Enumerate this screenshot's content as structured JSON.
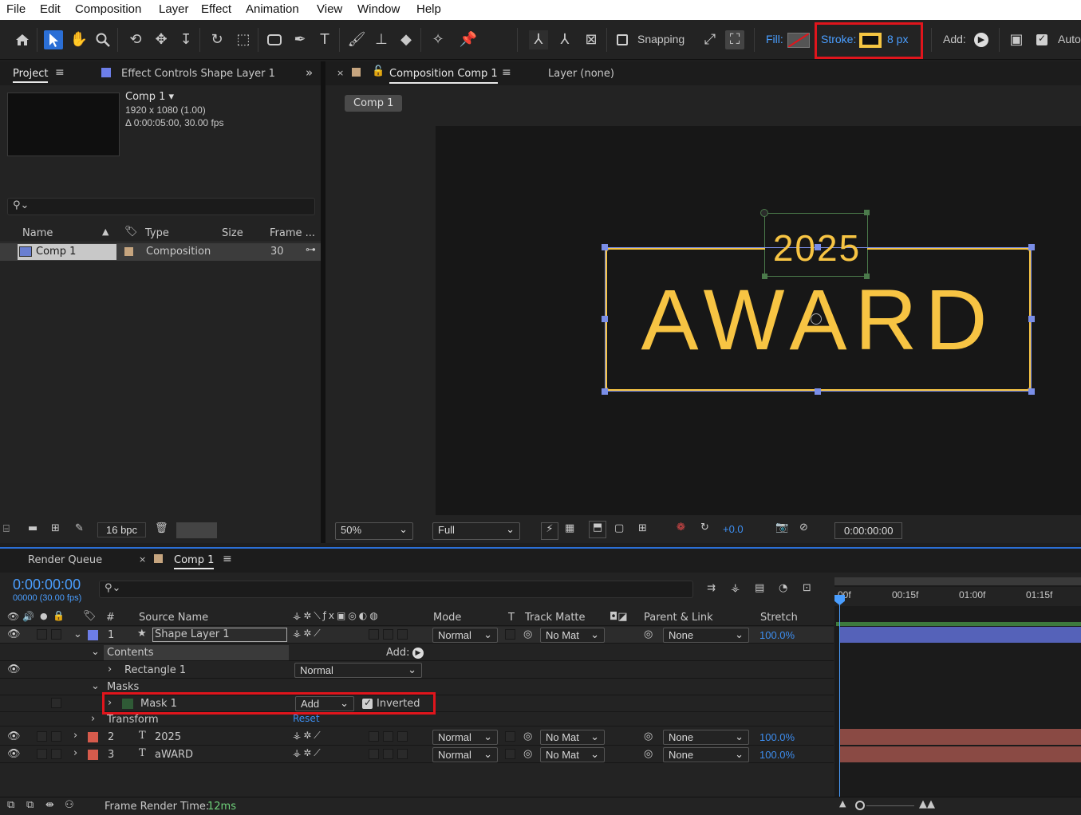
{
  "menu": [
    "File",
    "Edit",
    "Composition",
    "Layer",
    "Effect",
    "Animation",
    "View",
    "Window",
    "Help"
  ],
  "toolbar": {
    "snapping": "Snapping",
    "fill": "Fill:",
    "stroke": "Stroke:",
    "stroke_width": "8 px",
    "add": "Add:",
    "auto": "Auto",
    "stroke_color": "#f5c542"
  },
  "project": {
    "tab": "Project",
    "effect_tab": "Effect Controls Shape Layer 1",
    "comp_name": "Comp 1",
    "comp_size": "1920 x 1080 (1.00)",
    "comp_duration": "Δ 0:00:05:00, 30.00 fps",
    "cols": {
      "name": "Name",
      "type": "Type",
      "size": "Size",
      "frame": "Frame ..."
    },
    "item": {
      "name": "Comp 1",
      "type": "Composition",
      "frame": "30"
    },
    "bpc": "16 bpc"
  },
  "viewer": {
    "tab": "Composition Comp 1",
    "layer_tab": "Layer (none)",
    "breadcrumb": "Comp 1",
    "text_year": "2025",
    "text_main": "AWARD",
    "zoom": "50%",
    "quality": "Full",
    "exposure": "+0.0",
    "timecode": "0:00:00:00",
    "text_color": "#f7c443"
  },
  "timeline": {
    "render_tab": "Render Queue",
    "comp_tab": "Comp 1",
    "time": "0:00:00:00",
    "frames": "00000 (30.00 fps)",
    "cols": {
      "num": "#",
      "source": "Source Name",
      "mode": "Mode",
      "t": "T",
      "matte": "Track Matte",
      "parent": "Parent & Link",
      "stretch": "Stretch"
    },
    "ruler": [
      "00f",
      "00:15f",
      "01:00f",
      "01:15f"
    ],
    "layers": [
      {
        "num": "1",
        "name": "Shape Layer 1",
        "mode": "Normal",
        "matte": "No Mat",
        "parent": "None",
        "stretch": "100.0%",
        "color": "#6d7ee8"
      },
      {
        "num": "2",
        "name": "2025",
        "mode": "Normal",
        "matte": "No Mat",
        "parent": "None",
        "stretch": "100.0%",
        "color": "#d65b4c"
      },
      {
        "num": "3",
        "name": "aWARD",
        "mode": "Normal",
        "matte": "No Mat",
        "parent": "None",
        "stretch": "100.0%",
        "color": "#d65b4c"
      }
    ],
    "contents": "Contents",
    "add": "Add:",
    "rectangle": "Rectangle 1",
    "rect_mode": "Normal",
    "masks": "Masks",
    "mask": "Mask 1",
    "mask_mode": "Add",
    "inverted": "Inverted",
    "transform": "Transform",
    "reset": "Reset",
    "render_time_label": "Frame Render Time:",
    "render_time": "12ms"
  }
}
